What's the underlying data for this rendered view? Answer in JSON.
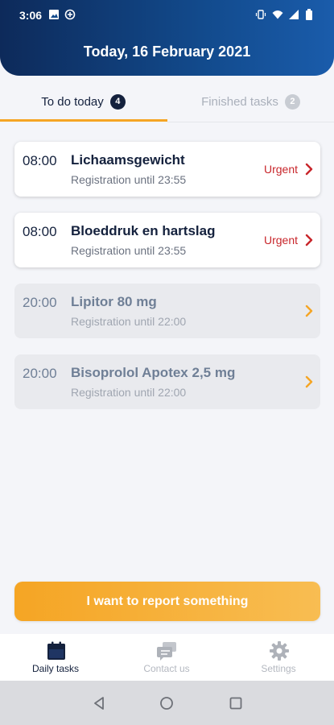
{
  "status_bar": {
    "time": "3:06"
  },
  "header": {
    "title": "Today, 16 February 2021"
  },
  "tabs": [
    {
      "label": "To do today",
      "count": "4"
    },
    {
      "label": "Finished tasks",
      "count": "2"
    }
  ],
  "tasks": [
    {
      "time": "08:00",
      "name": "Lichaamsgewicht",
      "sub": "Registration until 23:55",
      "status": "Urgent"
    },
    {
      "time": "08:00",
      "name": "Bloeddruk en hartslag",
      "sub": "Registration until 23:55",
      "status": "Urgent"
    },
    {
      "time": "20:00",
      "name": "Lipitor 80 mg",
      "sub": "Registration until 22:00"
    },
    {
      "time": "20:00",
      "name": "Bisoprolol Apotex 2,5 mg",
      "sub": "Registration until 22:00"
    }
  ],
  "report_button": {
    "label": "I want to report something"
  },
  "bottom_nav": [
    {
      "label": "Daily tasks",
      "icon": "calendar-icon"
    },
    {
      "label": "Contact us",
      "icon": "chat-icon"
    },
    {
      "label": "Settings",
      "icon": "gear-icon"
    }
  ],
  "colors": {
    "header_start": "#0d2a5a",
    "header_end": "#1a5cab",
    "accent_orange": "#f5a524",
    "urgent_red": "#c8262b",
    "navy": "#14213d"
  }
}
